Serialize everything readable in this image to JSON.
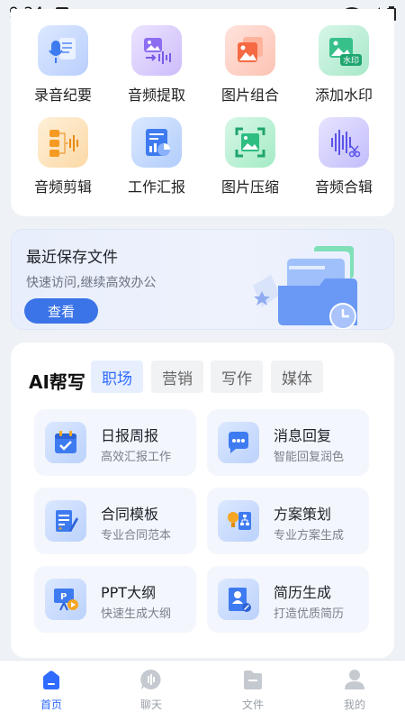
{
  "status": {
    "time": "9:24"
  },
  "tools": [
    {
      "label": "录音纪要",
      "icon": "microphone-document-icon"
    },
    {
      "label": "音频提取",
      "icon": "image-audio-extract-icon"
    },
    {
      "label": "图片组合",
      "icon": "stacked-images-icon"
    },
    {
      "label": "添加水印",
      "icon": "watermark-image-icon"
    },
    {
      "label": "音频剪辑",
      "icon": "audio-cut-icon"
    },
    {
      "label": "工作汇报",
      "icon": "report-chart-icon"
    },
    {
      "label": "图片压缩",
      "icon": "image-compress-icon"
    },
    {
      "label": "音频合辑",
      "icon": "audio-merge-icon"
    }
  ],
  "watermark_badge": "水印",
  "recent": {
    "title": "最近保存文件",
    "subtitle": "快速访问,继续高效办公",
    "button": "查看"
  },
  "ai": {
    "title": "AI帮写",
    "tabs": [
      "职场",
      "营销",
      "写作",
      "媒体"
    ],
    "items": [
      {
        "name": "日报周报",
        "desc": "高效汇报工作",
        "icon": "calendar-check-icon"
      },
      {
        "name": "消息回复",
        "desc": "智能回复润色",
        "icon": "chat-bubble-icon"
      },
      {
        "name": "合同模板",
        "desc": "专业合同范本",
        "icon": "contract-pen-icon"
      },
      {
        "name": "方案策划",
        "desc": "专业方案生成",
        "icon": "idea-flowchart-icon"
      },
      {
        "name": "PPT大纲",
        "desc": "快速生成大纲",
        "icon": "ppt-presentation-icon"
      },
      {
        "name": "简历生成",
        "desc": "打造优质简历",
        "icon": "resume-profile-icon"
      }
    ]
  },
  "nav": [
    {
      "label": "首页",
      "icon": "home-icon"
    },
    {
      "label": "聊天",
      "icon": "chat-icon"
    },
    {
      "label": "文件",
      "icon": "folder-icon"
    },
    {
      "label": "我的",
      "icon": "profile-icon"
    }
  ],
  "colors": {
    "accent": "#2f6bff",
    "button": "#3b74e7",
    "background": "#eef1f6"
  }
}
